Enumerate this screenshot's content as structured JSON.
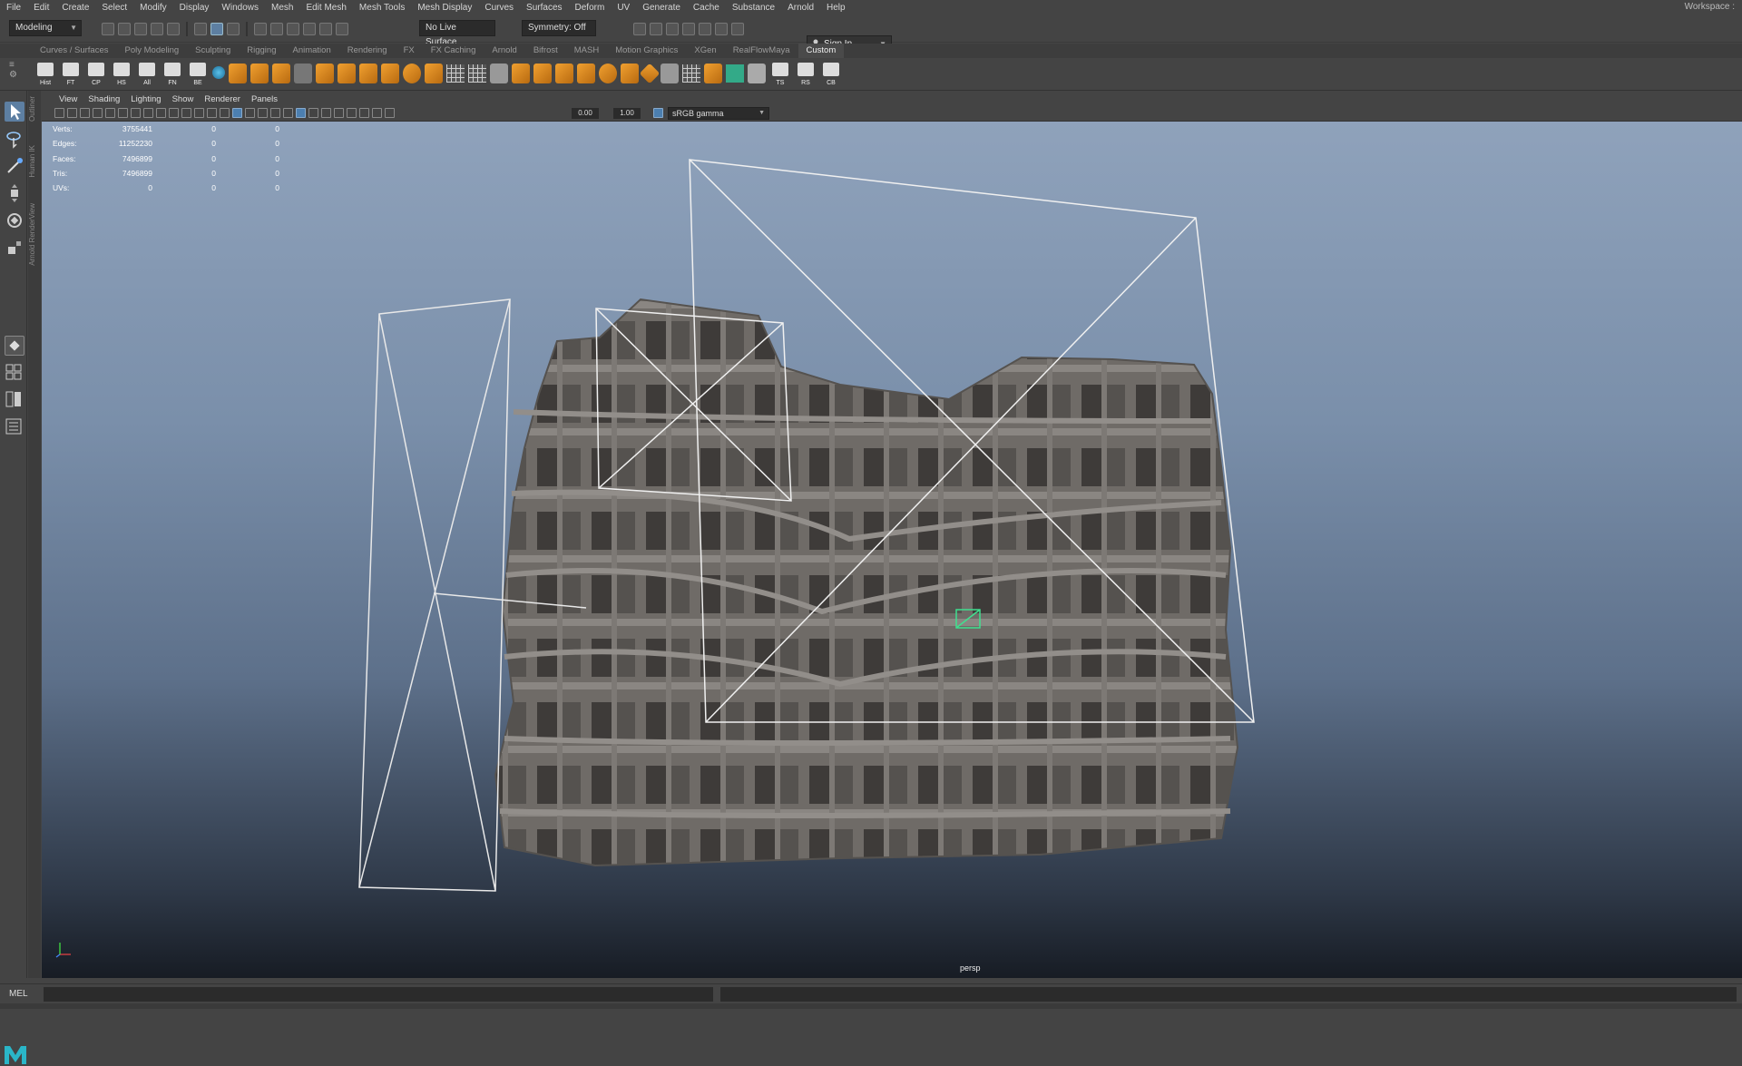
{
  "menu": [
    "File",
    "Edit",
    "Create",
    "Select",
    "Modify",
    "Display",
    "Windows",
    "Mesh",
    "Edit Mesh",
    "Mesh Tools",
    "Mesh Display",
    "Curves",
    "Surfaces",
    "Deform",
    "UV",
    "Generate",
    "Cache",
    "Substance",
    "Arnold",
    "Help"
  ],
  "workspace_label": "Workspace :",
  "status": {
    "mode": "Modeling",
    "live_surface": "No Live Surface",
    "symmetry": "Symmetry: Off",
    "sign_in": "Sign In"
  },
  "shelf_tabs": [
    "Curves / Surfaces",
    "Poly Modeling",
    "Sculpting",
    "Rigging",
    "Animation",
    "Rendering",
    "FX",
    "FX Caching",
    "Arnold",
    "Bifrost",
    "MASH",
    "Motion Graphics",
    "XGen",
    "RealFlowMaya",
    "Custom"
  ],
  "shelf_active": "Custom",
  "shelf_buttons": [
    "Hist",
    "FT",
    "CP",
    "HS",
    "All",
    "FN",
    "BE",
    "TS",
    "RS",
    "CB"
  ],
  "side_tabs": [
    "Outliner",
    "Human IK",
    "Arnold RenderView"
  ],
  "panel_menu": [
    "View",
    "Shading",
    "Lighting",
    "Show",
    "Renderer",
    "Panels"
  ],
  "panel_toolbar": {
    "exposure": "0.00",
    "gamma_value": "1.00",
    "color_space": "sRGB gamma"
  },
  "hud": [
    {
      "label": "Verts:",
      "a": "3755441",
      "b": "0",
      "c": "0"
    },
    {
      "label": "Edges:",
      "a": "11252230",
      "b": "0",
      "c": "0"
    },
    {
      "label": "Faces:",
      "a": "7496899",
      "b": "0",
      "c": "0"
    },
    {
      "label": "Tris:",
      "a": "7496899",
      "b": "0",
      "c": "0"
    },
    {
      "label": "UVs:",
      "a": "0",
      "c": "0",
      "b": "0"
    }
  ],
  "camera_name": "persp",
  "command_label": "MEL",
  "colors": {
    "ui_bg": "#444444",
    "selection": "#5d7fa2",
    "viewport_top": "#8fa2bb",
    "viewport_bottom": "#171c24",
    "mesh": "#6e6a66"
  }
}
